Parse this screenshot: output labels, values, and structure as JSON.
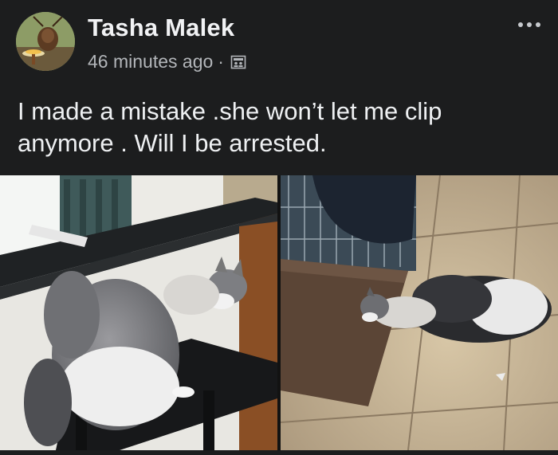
{
  "post": {
    "author": "Tasha Malek",
    "timestamp": "46 minutes ago",
    "separator": "·",
    "audience_icon": "friends-list-icon",
    "text": "I made a mistake .she won’t let me clip\nanymore . Will I be arrested.",
    "more_icon": "more-options-icon"
  },
  "colors": {
    "background": "#1c1d1e",
    "text_primary": "#eef0f2",
    "text_secondary": "#b3b6ba"
  }
}
